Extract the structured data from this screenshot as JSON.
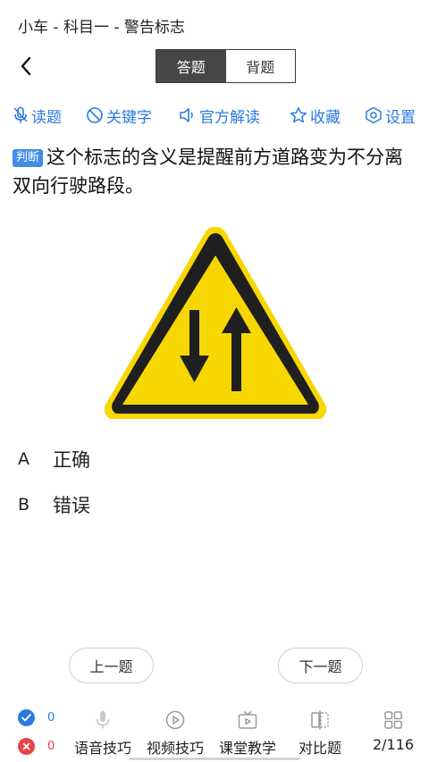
{
  "header": {
    "title": "小车 - 科目一 - 警告标志"
  },
  "nav": {
    "tabs": [
      {
        "label": "答题",
        "active": true
      },
      {
        "label": "背题",
        "active": false
      }
    ]
  },
  "toolbar": {
    "items": [
      {
        "label": "读题",
        "icon": "microphone-icon"
      },
      {
        "label": "关键字",
        "icon": "no-entry-icon"
      },
      {
        "label": "官方解读",
        "icon": "speaker-icon"
      },
      {
        "label": "收藏",
        "icon": "star-icon"
      },
      {
        "label": "设置",
        "icon": "gear-icon"
      }
    ],
    "color": "#2a7be0"
  },
  "question": {
    "type_badge": "判断",
    "text": "这个标志的含义是提醒前方道路变为不分离双向行驶路段。",
    "image": "warning-sign-two-way-traffic"
  },
  "options": [
    {
      "letter": "A",
      "text": "正确"
    },
    {
      "letter": "B",
      "text": "错误"
    }
  ],
  "navigation": {
    "prev": "上一题",
    "next": "下一题"
  },
  "footer": {
    "correct_count": "0",
    "wrong_count": "0",
    "items": [
      {
        "label": "语音技巧",
        "icon": "microphone-icon"
      },
      {
        "label": "视频技巧",
        "icon": "play-icon"
      },
      {
        "label": "课堂教学",
        "icon": "tv-icon"
      },
      {
        "label": "对比题",
        "icon": "compare-icon"
      }
    ],
    "progress": "2/116"
  },
  "colors": {
    "accent": "#2a7be0",
    "sign_yellow": "#f7d701",
    "correct": "#2a7be0",
    "wrong": "#e8424a"
  }
}
